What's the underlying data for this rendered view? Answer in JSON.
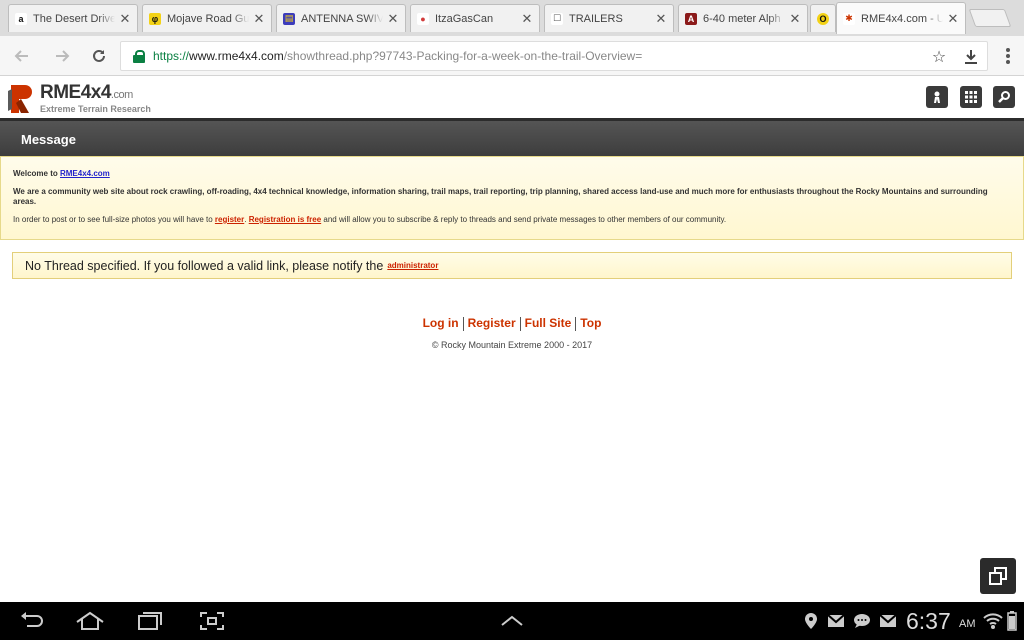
{
  "tabs": [
    {
      "title": "The Desert Drive",
      "favicon": "a",
      "favicon_color": "#ffffff",
      "favicon_fg": "#111111",
      "active": false
    },
    {
      "title": "Mojave Road Gu",
      "favicon": "φ",
      "favicon_color": "#f3d216",
      "favicon_fg": "#111111",
      "active": false
    },
    {
      "title": "ANTENNA SWIV",
      "favicon": "▤",
      "favicon_color": "#3c3cbb",
      "favicon_fg": "#f3d216",
      "active": false
    },
    {
      "title": "ItzaGasCan",
      "favicon": "●",
      "favicon_color": "#ffffff",
      "favicon_fg": "#d23b3b",
      "active": false
    },
    {
      "title": "TRAILERS",
      "favicon": "☐",
      "favicon_color": "#ffffff",
      "favicon_fg": "#555555",
      "active": false
    },
    {
      "title": "6-40 meter Alph",
      "favicon": "A",
      "favicon_color": "#8b1a1a",
      "favicon_fg": "#ffffff",
      "active": false
    },
    {
      "title": "",
      "favicon": "O",
      "favicon_color": "#f3d216",
      "favicon_fg": "#111111",
      "active": false
    },
    {
      "title": "RME4x4.com - U",
      "favicon": "✱",
      "favicon_color": "#ffffff",
      "favicon_fg": "#cc3300",
      "active": true
    }
  ],
  "address": {
    "scheme": "https://",
    "host": "www.rme4x4.com",
    "path": "/showthread.php?97743-Packing-for-a-week-on-the-trail-Overview="
  },
  "site": {
    "logo_name": "RME4x4",
    "logo_tld": ".com",
    "logo_tagline": "Extreme Terrain Research"
  },
  "message_title": "Message",
  "notice": {
    "welcome_prefix": "Welcome to ",
    "welcome_link": "RME4x4.com",
    "about": "We are a community web site about rock crawling, off-roading, 4x4 technical knowledge, information sharing, trail maps, trail reporting, trip planning, shared access land-use and much more for enthusiasts throughout the Rocky Mountains and surrounding areas.",
    "register_prefix": "In order to post or to see full-size photos you will have to ",
    "register_link": "register",
    "register_mid": ". ",
    "free_link": "Registration is free",
    "register_suffix": " and will allow you to subscribe & reply to threads and send private messages to other members of our community."
  },
  "error": {
    "text": "No Thread specified. If you followed a valid link, please notify the",
    "link": "administrator"
  },
  "footer": {
    "links": [
      "Log in",
      "Register",
      "Full Site",
      "Top"
    ],
    "copyright": "© Rocky Mountain Extreme 2000 - 2017"
  },
  "status": {
    "time": "6:37",
    "ampm": "AM"
  },
  "colors": {
    "link_red": "#cc3300",
    "url_green": "#0b8043",
    "header_dark": "#3d3d3d",
    "notice_bg": "#fff7d0"
  }
}
